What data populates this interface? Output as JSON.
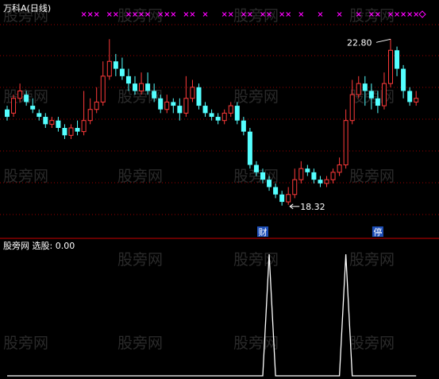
{
  "main_panel": {
    "title": "万科A(日线)",
    "high_label": "22.80",
    "low_label": "18.32",
    "badge_cai": "财",
    "badge_ting": "停"
  },
  "indicator_panel": {
    "label": "股旁网 选股: 0.00"
  },
  "watermark": "股旁网",
  "colors": {
    "background": "#000000",
    "up": "#ff3a3a",
    "down": "#54ffff",
    "grid": "#9a0000",
    "separator": "#cc0000",
    "marker": "#ff00ff",
    "indicator_line": "#ffffff",
    "badge_bg": "#1e4fb8"
  },
  "chart_data": {
    "type": "candlestick",
    "price_range": [
      17.8,
      23.0
    ],
    "candles": [
      [
        20.9,
        20.7,
        21.0,
        20.6
      ],
      [
        20.8,
        21.2,
        21.3,
        20.7
      ],
      [
        21.2,
        21.4,
        21.6,
        21.1
      ],
      [
        21.3,
        21.1,
        21.4,
        21.0
      ],
      [
        21.0,
        20.9,
        21.2,
        20.8
      ],
      [
        20.8,
        20.7,
        20.9,
        20.6
      ],
      [
        20.7,
        20.5,
        20.8,
        20.4
      ],
      [
        20.5,
        20.6,
        20.7,
        20.4
      ],
      [
        20.6,
        20.4,
        20.7,
        20.3
      ],
      [
        20.4,
        20.2,
        20.5,
        20.1
      ],
      [
        20.2,
        20.4,
        20.5,
        20.1
      ],
      [
        20.4,
        20.3,
        20.6,
        20.2
      ],
      [
        20.3,
        20.6,
        21.4,
        20.2
      ],
      [
        20.6,
        20.9,
        21.2,
        20.5
      ],
      [
        20.9,
        21.1,
        21.5,
        20.8
      ],
      [
        21.1,
        21.8,
        22.2,
        21.0
      ],
      [
        21.8,
        22.2,
        22.8,
        21.7
      ],
      [
        22.2,
        22.0,
        22.4,
        21.8
      ],
      [
        22.0,
        21.8,
        22.3,
        21.7
      ],
      [
        21.8,
        21.6,
        22.0,
        21.4
      ],
      [
        21.6,
        21.4,
        21.8,
        21.3
      ],
      [
        21.4,
        21.6,
        21.9,
        21.3
      ],
      [
        21.6,
        21.4,
        21.9,
        21.3
      ],
      [
        21.4,
        21.2,
        21.6,
        21.1
      ],
      [
        21.2,
        20.9,
        21.3,
        20.8
      ],
      [
        20.9,
        21.1,
        21.3,
        20.8
      ],
      [
        21.1,
        21.0,
        21.2,
        20.8
      ],
      [
        21.0,
        20.8,
        21.2,
        20.6
      ],
      [
        20.8,
        21.2,
        21.8,
        20.7
      ],
      [
        21.2,
        21.5,
        21.7,
        21.1
      ],
      [
        21.5,
        21.0,
        21.6,
        20.9
      ],
      [
        21.0,
        20.8,
        21.1,
        20.7
      ],
      [
        20.8,
        20.7,
        20.9,
        20.6
      ],
      [
        20.7,
        20.6,
        20.8,
        20.5
      ],
      [
        20.6,
        20.8,
        20.9,
        20.5
      ],
      [
        20.8,
        21.0,
        21.1,
        20.7
      ],
      [
        21.0,
        20.6,
        21.1,
        20.5
      ],
      [
        20.6,
        20.3,
        20.7,
        20.2
      ],
      [
        20.3,
        19.4,
        20.4,
        19.3
      ],
      [
        19.4,
        19.2,
        19.5,
        19.1
      ],
      [
        19.2,
        19.0,
        19.3,
        18.9
      ],
      [
        19.0,
        18.8,
        19.1,
        18.7
      ],
      [
        18.8,
        18.6,
        18.9,
        18.5
      ],
      [
        18.6,
        18.4,
        18.7,
        18.3
      ],
      [
        18.4,
        18.6,
        18.8,
        18.32
      ],
      [
        18.6,
        19.0,
        19.3,
        18.5
      ],
      [
        19.0,
        19.3,
        19.5,
        18.9
      ],
      [
        19.3,
        19.2,
        19.4,
        19.1
      ],
      [
        19.2,
        19.0,
        19.3,
        18.9
      ],
      [
        19.0,
        18.9,
        19.1,
        18.8
      ],
      [
        18.9,
        19.0,
        19.1,
        18.8
      ],
      [
        19.0,
        19.2,
        19.3,
        18.9
      ],
      [
        19.2,
        19.4,
        19.6,
        19.1
      ],
      [
        19.4,
        20.6,
        20.9,
        19.3
      ],
      [
        20.6,
        21.3,
        21.7,
        20.5
      ],
      [
        21.3,
        21.6,
        21.8,
        21.2
      ],
      [
        21.6,
        21.4,
        21.8,
        21.0
      ],
      [
        21.4,
        21.2,
        21.6,
        20.9
      ],
      [
        21.2,
        21.0,
        21.4,
        20.8
      ],
      [
        21.0,
        21.6,
        21.9,
        20.9
      ],
      [
        21.6,
        22.5,
        22.8,
        21.5
      ],
      [
        22.5,
        22.0,
        22.6,
        21.8
      ],
      [
        22.0,
        21.4,
        22.1,
        21.2
      ],
      [
        21.4,
        21.1,
        21.5,
        21.0
      ],
      [
        21.1,
        21.2,
        21.4,
        21.0
      ]
    ],
    "high_index": 60,
    "low_index": 44,
    "signals": [
      0,
      0,
      0,
      0,
      0,
      0,
      0,
      0,
      0,
      0,
      0,
      0,
      0,
      0,
      0,
      0,
      0,
      0,
      0,
      0,
      0,
      0,
      0,
      0,
      0,
      0,
      0,
      0,
      0,
      0,
      0,
      0,
      0,
      0,
      0,
      0,
      0,
      0,
      0,
      0,
      0,
      1,
      0,
      0,
      0,
      0,
      0,
      0,
      0,
      0,
      0,
      0,
      0,
      1,
      0,
      0,
      0,
      0,
      0,
      0,
      0,
      0,
      0,
      0,
      0
    ],
    "marker_slots": [
      12,
      13,
      14,
      16,
      17,
      19,
      20,
      21,
      22,
      24,
      25,
      26,
      28,
      29,
      31,
      34,
      35,
      37,
      38,
      40,
      41,
      43,
      44,
      46,
      49,
      52,
      55,
      57,
      58,
      60,
      61,
      62,
      63,
      64
    ],
    "cai_index": 40,
    "ting_index": 58
  }
}
